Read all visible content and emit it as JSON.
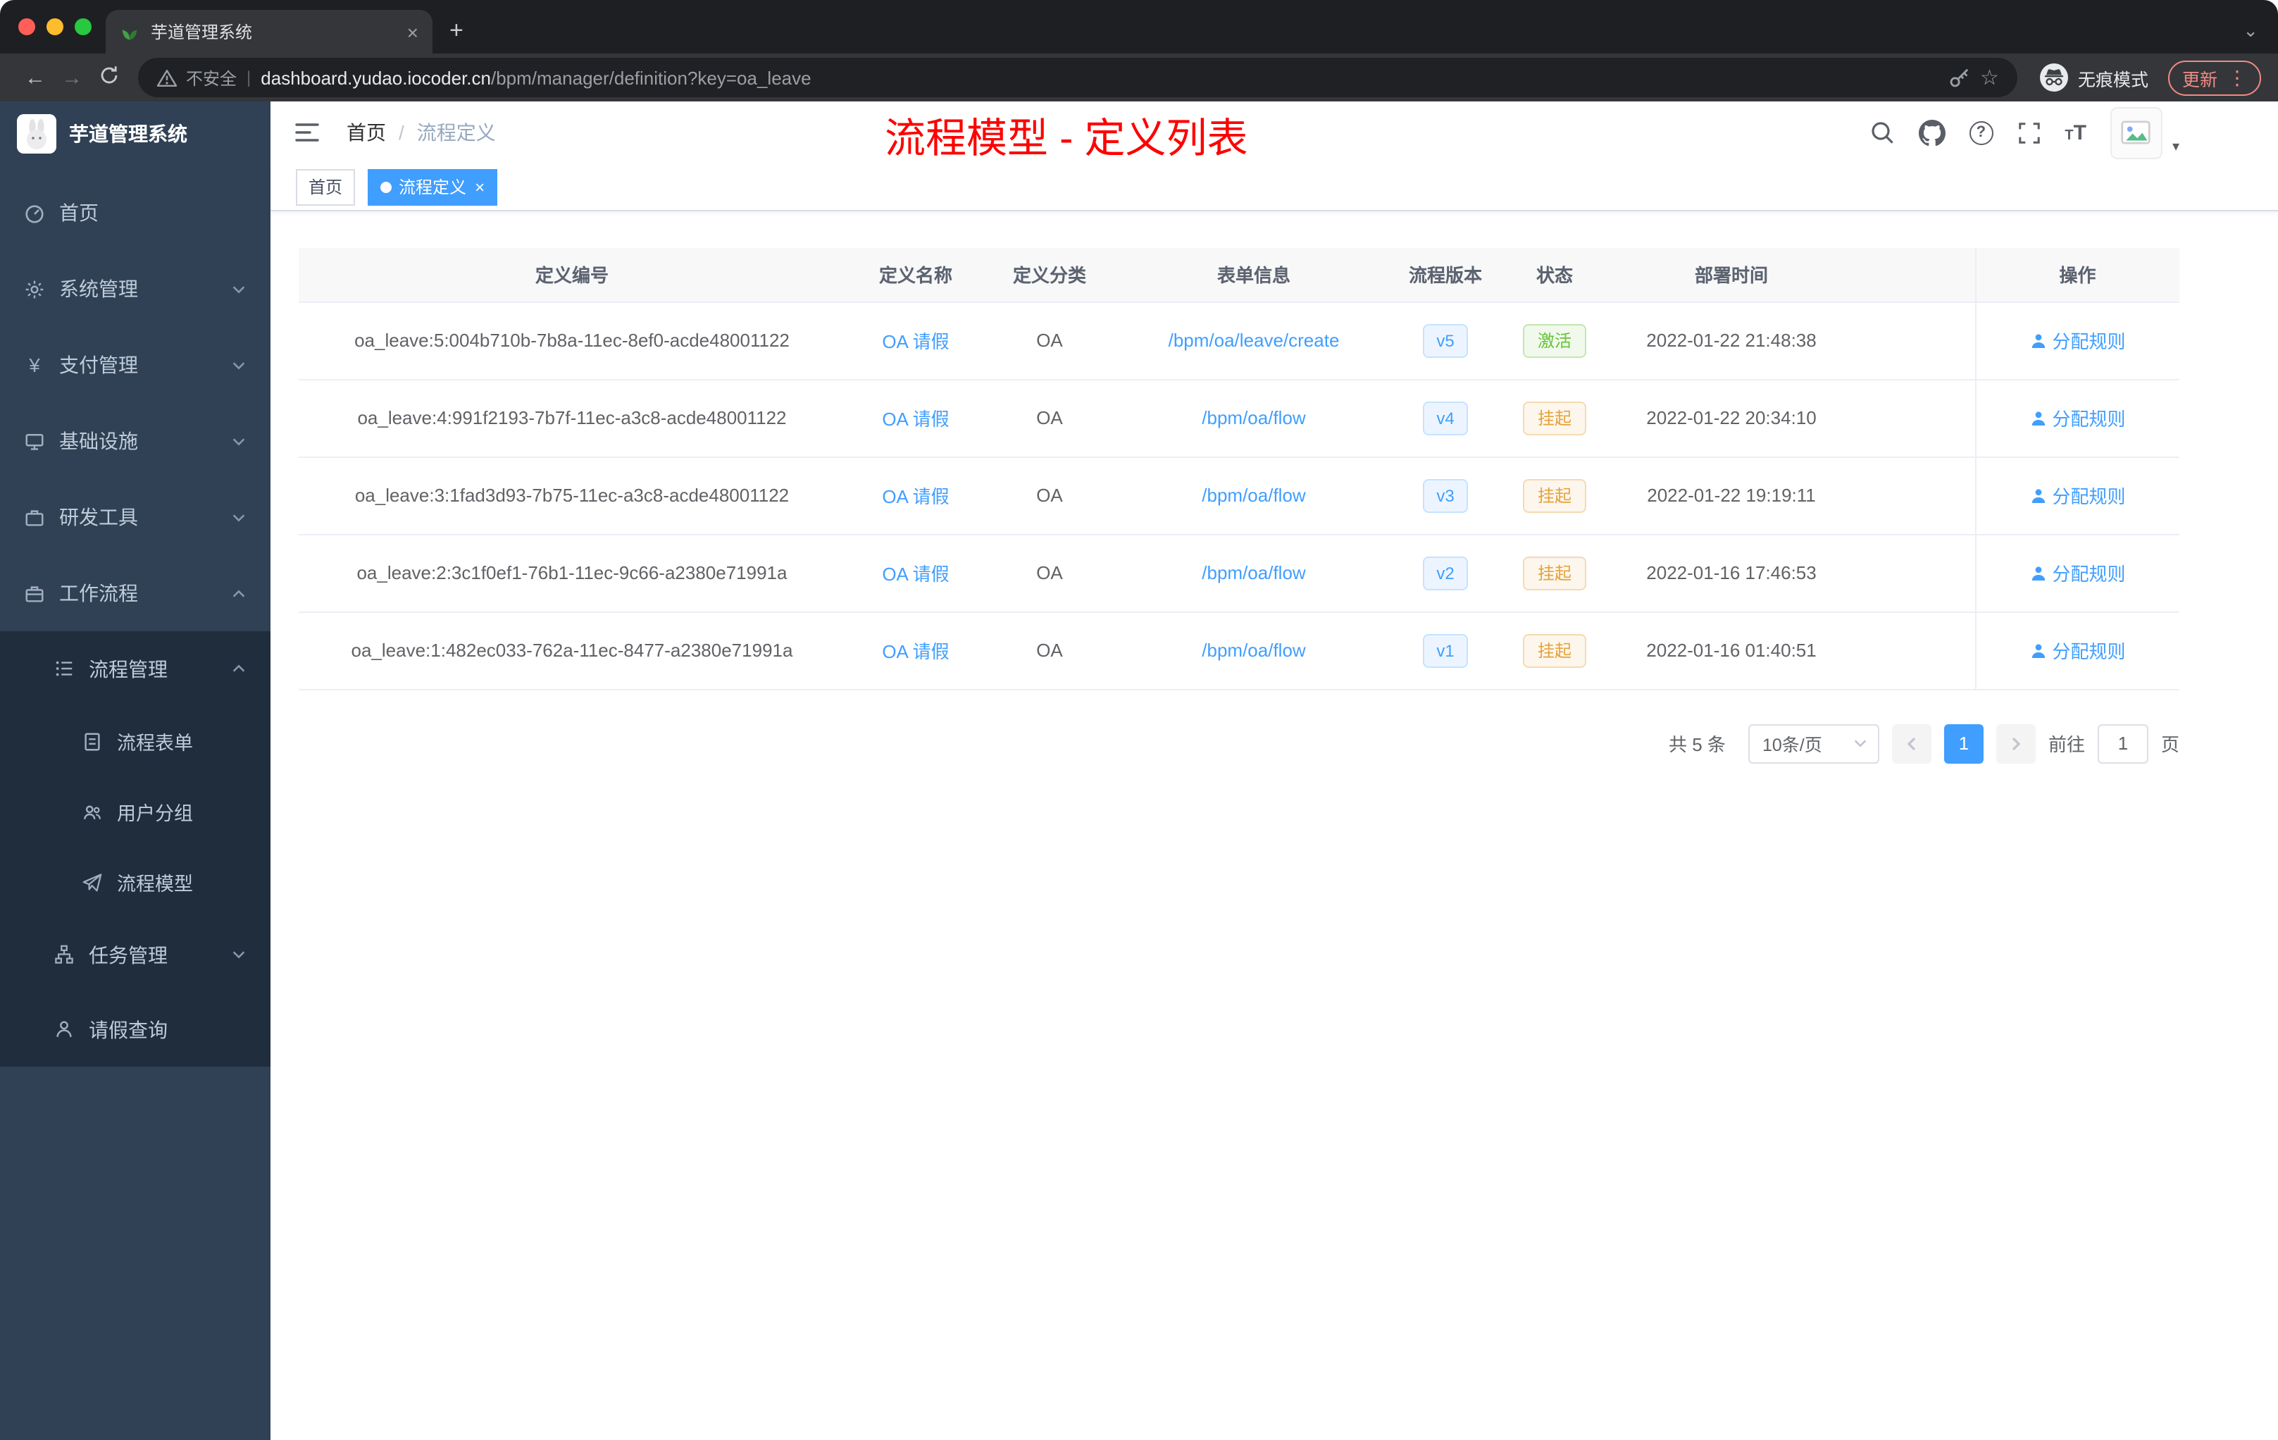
{
  "colors": {
    "accent": "#409eff",
    "success": "#67c23a",
    "warning": "#e6a23c",
    "sidebar_bg": "#304156",
    "sidebar_sub_bg": "#1f2d3d",
    "annotation": "#fe0000"
  },
  "icons": {
    "yen": "¥",
    "star": "☆",
    "question": "?",
    "plus": "+",
    "close_tab": "×",
    "tag_close": "×",
    "menu_dots": "⋮",
    "caret_down": "▾",
    "chevron_down": "⌄",
    "back": "←",
    "forward": "→",
    "divider": "|",
    "breadcrumb_sep": "/",
    "font_small": "T",
    "font_large": "T"
  },
  "browser": {
    "tab_title": "芋道管理系统",
    "security_label": "不安全",
    "url_host": "dashboard.yudao.iocoder.cn",
    "url_path": "/bpm/manager/definition?key=oa_leave",
    "incognito_label": "无痕模式",
    "update_label": "更新"
  },
  "sidebar": {
    "logo_title": "芋道管理系统",
    "items": [
      {
        "label": "首页"
      },
      {
        "label": "系统管理"
      },
      {
        "label": "支付管理"
      },
      {
        "label": "基础设施"
      },
      {
        "label": "研发工具"
      },
      {
        "label": "工作流程"
      },
      {
        "label": "流程管理"
      },
      {
        "label": "流程表单"
      },
      {
        "label": "用户分组"
      },
      {
        "label": "流程模型"
      },
      {
        "label": "任务管理"
      },
      {
        "label": "请假查询"
      }
    ]
  },
  "navbar": {
    "breadcrumb_home": "首页",
    "breadcrumb_current": "流程定义",
    "annotation": "流程模型 - 定义列表"
  },
  "tags": {
    "home": "首页",
    "current": "流程定义"
  },
  "table": {
    "columns": [
      "定义编号",
      "定义名称",
      "定义分类",
      "表单信息",
      "流程版本",
      "状态",
      "部署时间",
      "操作"
    ],
    "rows": [
      {
        "id": "oa_leave:5:004b710b-7b8a-11ec-8ef0-acde48001122",
        "name": "OA 请假",
        "category": "OA",
        "form": "/bpm/oa/leave/create",
        "version": "v5",
        "status": "激活",
        "status_type": "success",
        "time": "2022-01-22 21:48:38",
        "action": "分配规则"
      },
      {
        "id": "oa_leave:4:991f2193-7b7f-11ec-a3c8-acde48001122",
        "name": "OA 请假",
        "category": "OA",
        "form": "/bpm/oa/flow",
        "version": "v4",
        "status": "挂起",
        "status_type": "warning",
        "time": "2022-01-22 20:34:10",
        "action": "分配规则"
      },
      {
        "id": "oa_leave:3:1fad3d93-7b75-11ec-a3c8-acde48001122",
        "name": "OA 请假",
        "category": "OA",
        "form": "/bpm/oa/flow",
        "version": "v3",
        "status": "挂起",
        "status_type": "warning",
        "time": "2022-01-22 19:19:11",
        "action": "分配规则"
      },
      {
        "id": "oa_leave:2:3c1f0ef1-76b1-11ec-9c66-a2380e71991a",
        "name": "OA 请假",
        "category": "OA",
        "form": "/bpm/oa/flow",
        "version": "v2",
        "status": "挂起",
        "status_type": "warning",
        "time": "2022-01-16 17:46:53",
        "action": "分配规则"
      },
      {
        "id": "oa_leave:1:482ec033-762a-11ec-8477-a2380e71991a",
        "name": "OA 请假",
        "category": "OA",
        "form": "/bpm/oa/flow",
        "version": "v1",
        "status": "挂起",
        "status_type": "warning",
        "time": "2022-01-16 01:40:51",
        "action": "分配规则"
      }
    ]
  },
  "pagination": {
    "total": "共 5 条",
    "page_size": "10条/页",
    "page": "1",
    "goto_label": "前往",
    "goto_value": "1",
    "unit_label": "页"
  }
}
